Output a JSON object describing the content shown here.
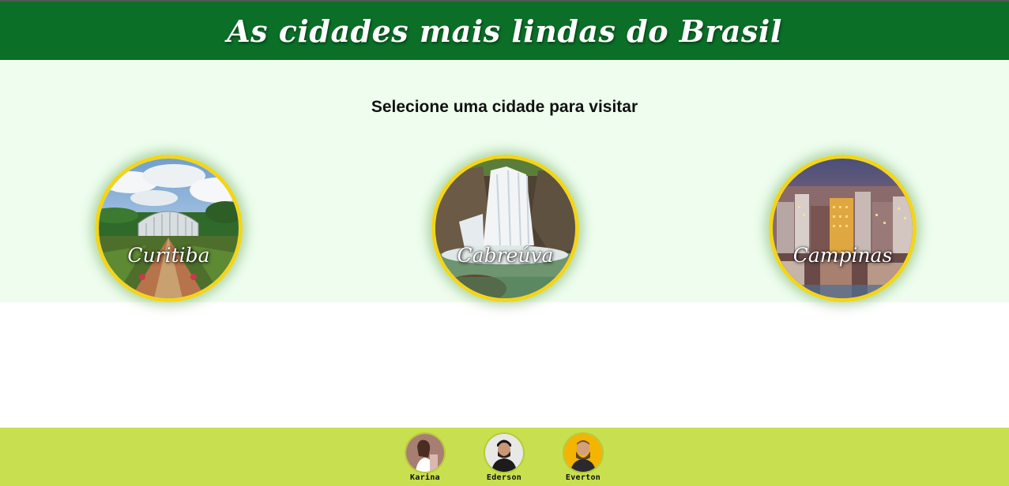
{
  "header": {
    "title": "As cidades mais lindas do Brasil"
  },
  "main": {
    "prompt": "Selecione uma cidade para visitar",
    "cities": [
      {
        "name": "Curitiba"
      },
      {
        "name": "Cabreúva"
      },
      {
        "name": "Campinas"
      }
    ]
  },
  "footer": {
    "members": [
      {
        "name": "Karina"
      },
      {
        "name": "Ederson"
      },
      {
        "name": "Everton"
      }
    ]
  },
  "colors": {
    "header_bg": "#0b6f28",
    "section_bg": "#eefdee",
    "card_border": "#f2d51c",
    "footer_bg": "#c8e050"
  }
}
